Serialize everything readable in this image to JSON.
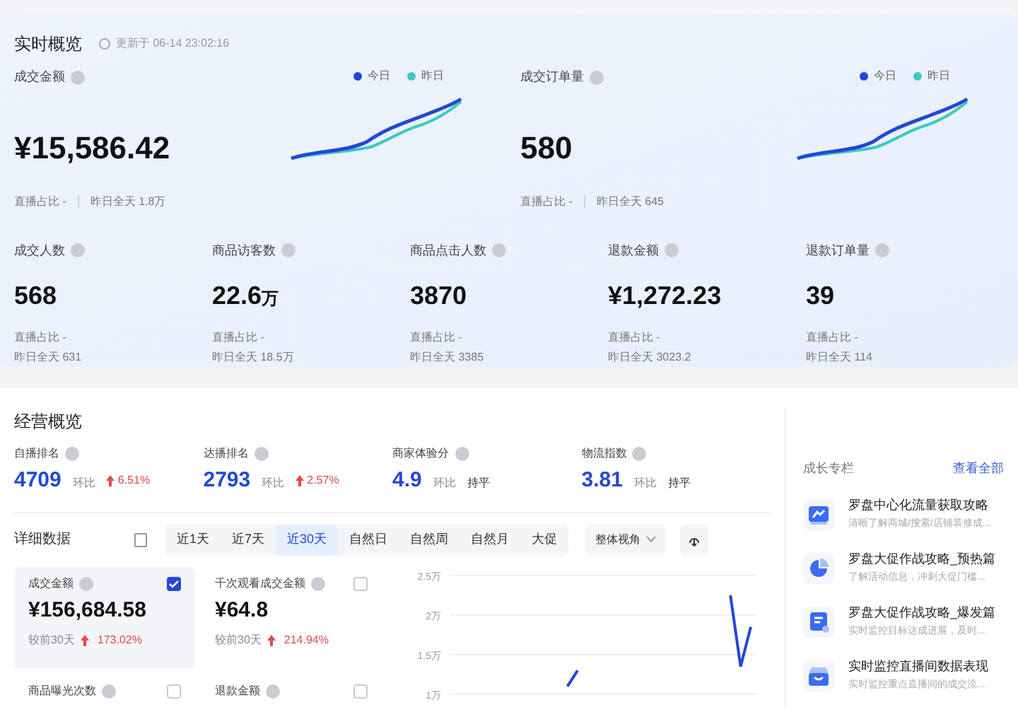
{
  "realtime": {
    "title": "实时概览",
    "updated": "更新于 06-14 23:02:16",
    "main_metrics": [
      {
        "label": "成交金额",
        "value": "¥15,586.42",
        "share": "直播占比 -",
        "yesterday": "昨日全天 1.8万",
        "legend": [
          {
            "label": "今日",
            "color": "#2347d6"
          },
          {
            "label": "昨日",
            "color": "#3cc8c0"
          }
        ]
      },
      {
        "label": "成交订单量",
        "value": "580",
        "share": "直播占比 -",
        "yesterday": "昨日全天 645",
        "legend": [
          {
            "label": "今日",
            "color": "#2347d6"
          },
          {
            "label": "昨日",
            "color": "#3cc8c0"
          }
        ]
      }
    ],
    "metrics": [
      {
        "label": "成交人数",
        "value": "568",
        "share": "直播占比 -",
        "yesterday": "昨日全天 631"
      },
      {
        "label": "商品访客数",
        "value": "22.6",
        "unit": "万",
        "share": "直播占比 -",
        "yesterday": "昨日全天 18.5万"
      },
      {
        "label": "商品点击人数",
        "value": "3870",
        "share": "直播占比 -",
        "yesterday": "昨日全天 3385"
      },
      {
        "label": "退款金额",
        "value": "¥1,272.23",
        "share": "直播占比 -",
        "yesterday": "昨日全天 3023.2"
      },
      {
        "label": "退款订单量",
        "value": "39",
        "share": "直播占比 -",
        "yesterday": "昨日全天 114"
      }
    ]
  },
  "business": {
    "title": "经营概览",
    "ranks": [
      {
        "label": "自播排名",
        "value": "4709",
        "compare": "环比",
        "change": "6.51%",
        "rising": true
      },
      {
        "label": "达播排名",
        "value": "2793",
        "compare": "环比",
        "change": "2.57%",
        "rising": true
      },
      {
        "label": "商家体验分",
        "value": "4.9",
        "compare": "环比",
        "change": "持平",
        "rising": false
      },
      {
        "label": "物流指数",
        "value": "3.81",
        "compare": "环比",
        "change": "持平",
        "rising": false
      }
    ],
    "detail_title": "详细数据",
    "tabs": [
      {
        "label": "近1天",
        "selected": false
      },
      {
        "label": "近7天",
        "selected": false
      },
      {
        "label": "近30天",
        "selected": true
      },
      {
        "label": "自然日",
        "selected": false
      },
      {
        "label": "自然周",
        "selected": false
      },
      {
        "label": "自然月",
        "selected": false
      },
      {
        "label": "大促",
        "selected": false
      }
    ],
    "view_select": "整体视角",
    "cards": [
      {
        "label": "成交金额",
        "value": "¥156,684.58",
        "compare": "较前30天",
        "change": "173.02%",
        "rising": true,
        "checked": true
      },
      {
        "label": "千次观看成交金额",
        "value": "¥64.8",
        "compare": "较前30天",
        "change": "214.94%",
        "rising": true,
        "checked": false
      },
      {
        "label": "商品曝光次数",
        "checked": false
      },
      {
        "label": "退款金额",
        "checked": false
      }
    ],
    "chart_data": {
      "type": "line",
      "grid": true,
      "ylim": [
        1,
        2.5
      ],
      "yticks": [
        {
          "value": 1,
          "label": "1万"
        },
        {
          "value": 1.5,
          "label": "1.5万"
        },
        {
          "value": 2,
          "label": "2万"
        },
        {
          "value": 2.5,
          "label": "2.5万"
        }
      ],
      "series": [
        {
          "color": "#2347d6",
          "values": [
            null,
            null,
            null,
            null,
            null,
            null,
            null,
            null,
            null,
            null,
            null,
            1.1,
            1.3,
            null,
            null,
            null,
            null,
            null,
            null,
            null,
            null,
            null,
            null,
            null,
            null,
            null,
            null,
            2.25,
            1.35,
            1.85
          ]
        }
      ]
    }
  },
  "growth": {
    "title": "成长专栏",
    "link": "查看全部",
    "items": [
      {
        "kind": "trend",
        "title": "罗盘中心化流量获取攻略",
        "desc": "清晰了解商城/搜索/店铺装修成..."
      },
      {
        "kind": "pie",
        "title": "罗盘大促作战攻略_预热篇",
        "desc": "了解活动信息，冲刺大促门槛..."
      },
      {
        "kind": "doc",
        "title": "罗盘大促作战攻略_爆发篇",
        "desc": "实时监控目标达成进展，及时..."
      },
      {
        "kind": "basket",
        "title": "实时监控直播间数据表现",
        "desc": "实时监控重点直播间的成交流..."
      }
    ]
  }
}
